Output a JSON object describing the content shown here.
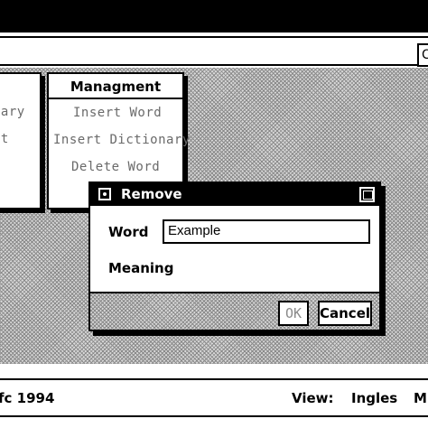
{
  "toolbar": {
    "button_label": "C"
  },
  "left_menu": {
    "items": [
      "nary",
      "nt"
    ]
  },
  "management_menu": {
    "title": "Managment",
    "items": [
      "Insert Word",
      "Insert Dictionary",
      "Delete Word"
    ]
  },
  "remove_dialog": {
    "title": "Remove",
    "word_label": "Word",
    "word_value": "Example",
    "meaning_label": "Meaning",
    "ok_label": "OK",
    "cancel_label": "Cancel"
  },
  "status": {
    "copyright": "fc 1994",
    "view_label": "View:",
    "view_value": "Ingles",
    "cut_off": "M"
  }
}
